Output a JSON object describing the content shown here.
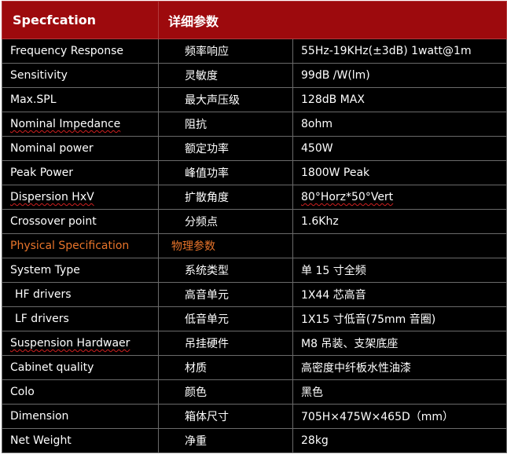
{
  "header": {
    "col1": "Specfcation",
    "col2": "详细参数"
  },
  "rows": [
    {
      "en": "Frequency Response",
      "cn": "频率响应",
      "value": "55Hz-19KHz(±3dB) 1watt@1m"
    },
    {
      "en": "Sensitivity",
      "cn": "灵敏度",
      "value": "99dB /W(lm)"
    },
    {
      "en": "Max.SPL",
      "cn": "最大声压级",
      "value": "128dB MAX"
    },
    {
      "en": "Nominal Impedance",
      "cn": "阻抗",
      "value": "8ohm"
    },
    {
      "en": "Nominal power",
      "cn": "额定功率",
      "value": "450W"
    },
    {
      "en": "Peak Power",
      "cn": "峰值功率",
      "value": "1800W Peak"
    },
    {
      "en": "Dispersion HxV",
      "cn": "扩散角度",
      "value": "80°Horz*50°Vert"
    },
    {
      "en": "Crossover point",
      "cn": "分频点",
      "value": "1.6Khz"
    }
  ],
  "section": {
    "en": "Physical Specification",
    "cn": "物理参数",
    "value": ""
  },
  "physical_rows": [
    {
      "en": "System Type",
      "cn": "系统类型",
      "value": "单 15 寸全频"
    },
    {
      "en": "HF drivers",
      "cn": "高音单元",
      "value": "1X44 芯高音"
    },
    {
      "en": "LF drivers",
      "cn": "低音单元",
      "value": "1X15 寸低音(75mm 音圈)"
    },
    {
      "en": "Suspension Hardwaer",
      "cn": "吊挂硬件",
      "value": "M8 吊装、支架底座"
    },
    {
      "en": "Cabinet quality",
      "cn": "材质",
      "value": "高密度中纤板水性油漆"
    },
    {
      "en": "Colo",
      "cn": "颜色",
      "value": "黑色"
    },
    {
      "en": "Dimension",
      "cn": "箱体尺寸",
      "value": "705H×475W×465D（mm）"
    },
    {
      "en": "Net Weight",
      "cn": "净重",
      "value": "28kg"
    }
  ],
  "colors": {
    "header_bg": "#9d0a0d",
    "table_bg": "#000000",
    "section_text": "#e8742a",
    "text": "#ffffff"
  }
}
